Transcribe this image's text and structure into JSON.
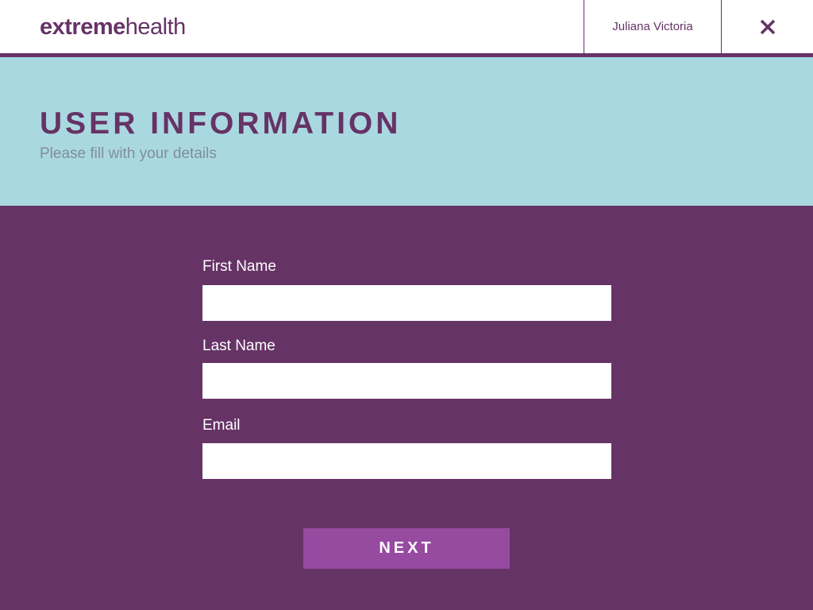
{
  "header": {
    "logo_bold": "extreme",
    "logo_light": "health",
    "user_name": "Juliana Victoria",
    "close_icon": "close-icon"
  },
  "banner": {
    "title": "USER INFORMATION",
    "subtitle": "Please fill with your details"
  },
  "form": {
    "fields": [
      {
        "label": "First Name",
        "value": "",
        "placeholder": ""
      },
      {
        "label": "Last Name",
        "value": "",
        "placeholder": ""
      },
      {
        "label": "Email",
        "value": "",
        "placeholder": ""
      }
    ],
    "next_label": "NEXT"
  },
  "colors": {
    "brand_purple": "#663366",
    "banner_blue": "#aad8e0",
    "button_purple": "#964aa0",
    "subtitle_gray": "#7f8e9c"
  }
}
